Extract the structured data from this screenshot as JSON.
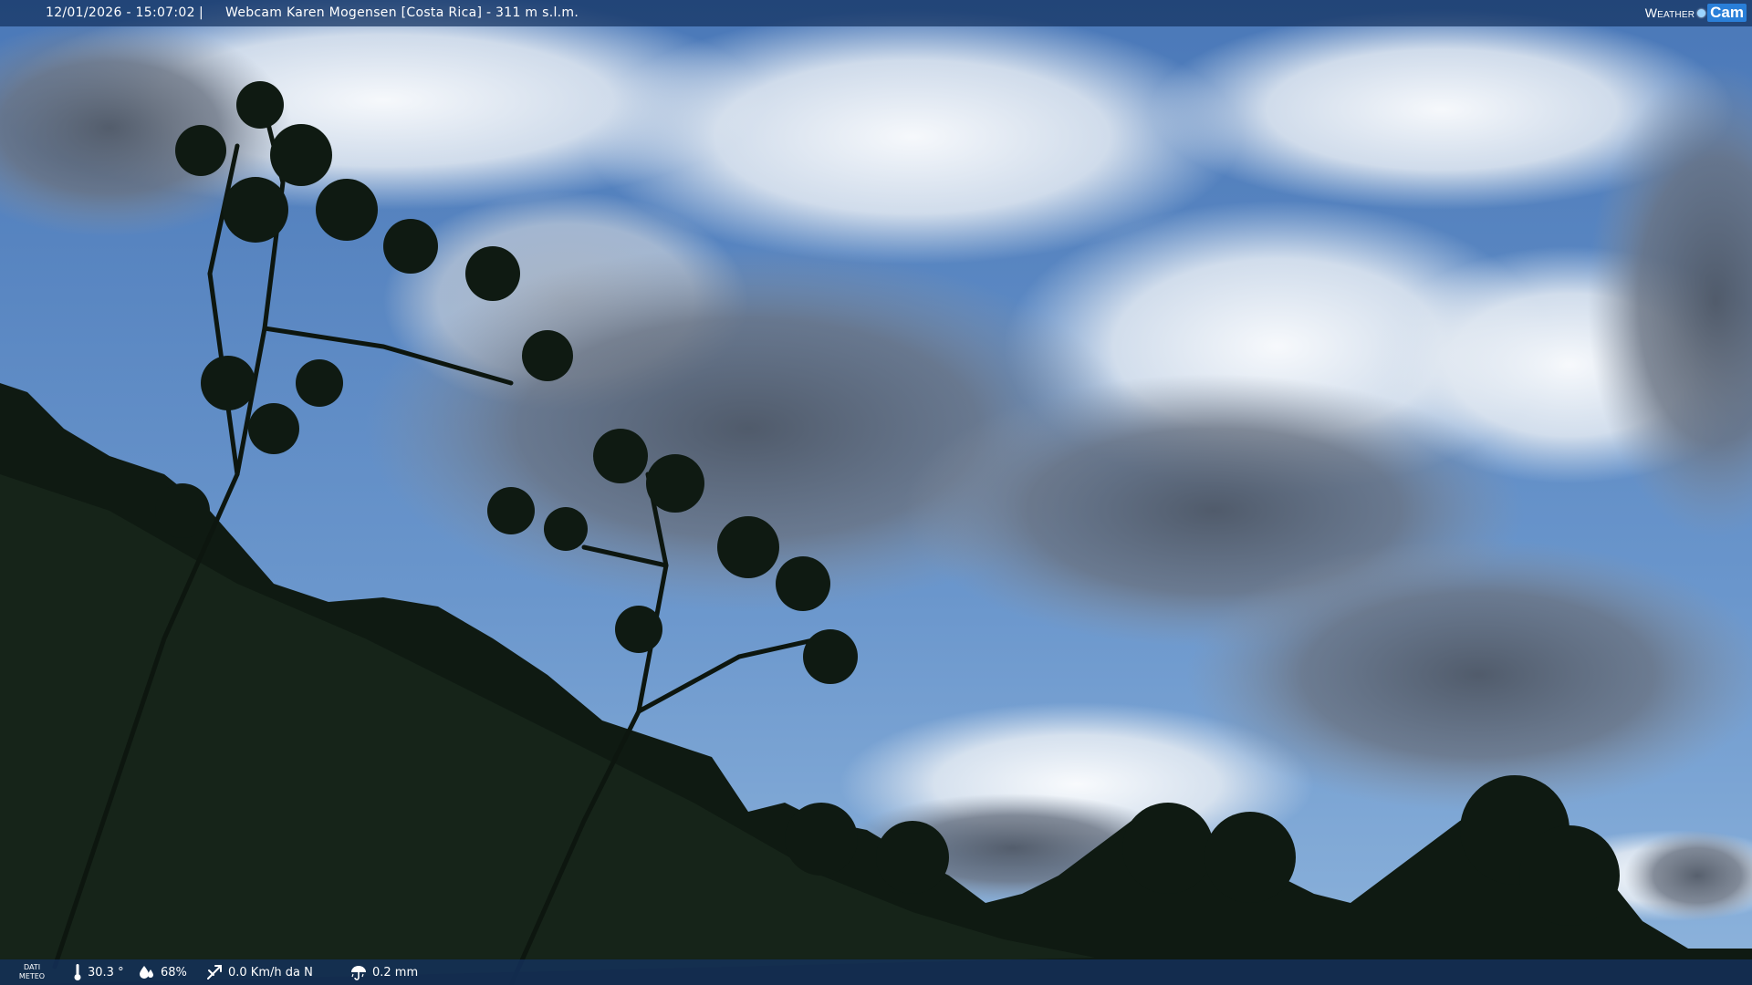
{
  "topbar": {
    "timestamp": "12/01/2026 - 15:07:02",
    "separator": "|",
    "title": "Webcam Karen Mogensen [Costa Rica]  - 311 m s.l.m."
  },
  "logo": {
    "weather": "Weather",
    "cam": "Cam"
  },
  "bottombar": {
    "dati_line1": "DATI",
    "dati_line2": "METEO",
    "temperature": "30.3 °",
    "humidity": "68%",
    "wind": "0.0 Km/h da N",
    "rain": "0.2 mm"
  },
  "icons": [
    "thermometer-icon",
    "humidity-drop-icon",
    "wind-icon",
    "rain-umbrella-icon"
  ],
  "colors": {
    "bar": "#14325f",
    "sky": "#5f88c0",
    "logo_accent": "#2a7fd8"
  }
}
